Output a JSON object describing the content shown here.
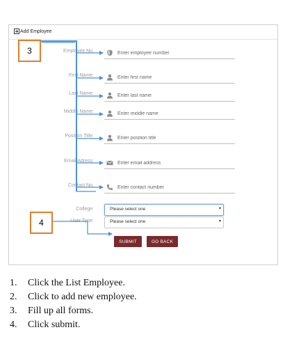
{
  "panel": {
    "title": "Add Employee"
  },
  "form": {
    "fields": [
      {
        "label": "Employee No.",
        "placeholder": "Enter employee number",
        "icon": "shield-icon"
      },
      {
        "label": "First Name:",
        "placeholder": "Enter first name",
        "icon": "user-icon"
      },
      {
        "label": "Last Name:",
        "placeholder": "Enter last name",
        "icon": "user-icon"
      },
      {
        "label": "Middle Name:",
        "placeholder": "Enter middle name",
        "icon": "user-icon"
      },
      {
        "label": "Position Title:",
        "placeholder": "Enter position title",
        "icon": "user-icon"
      },
      {
        "label": "Email Adress:",
        "placeholder": "Enter email address",
        "icon": "envelope-icon"
      },
      {
        "label": "Contact No.",
        "placeholder": "Enter contact number",
        "icon": "phone-icon"
      }
    ],
    "college": {
      "label": "College:",
      "value": "Please select one"
    },
    "user_type": {
      "label": "User Type:",
      "value": "Please select one"
    },
    "submit_label": "SUBMIT",
    "back_label": "GO BACK"
  },
  "callouts": {
    "three": "3",
    "four": "4"
  },
  "steps": [
    {
      "num": "1.",
      "text": "Click the List Employee."
    },
    {
      "num": "2.",
      "text": "Click to add new employee."
    },
    {
      "num": "3.",
      "text": "Fill up all forms."
    },
    {
      "num": "4.",
      "text": "Click submit."
    }
  ],
  "colors": {
    "accent_button": "#7a2a2c",
    "callout_border": "#e07e27",
    "arrow": "#4a90d9",
    "icon": "#8a8a8a"
  }
}
